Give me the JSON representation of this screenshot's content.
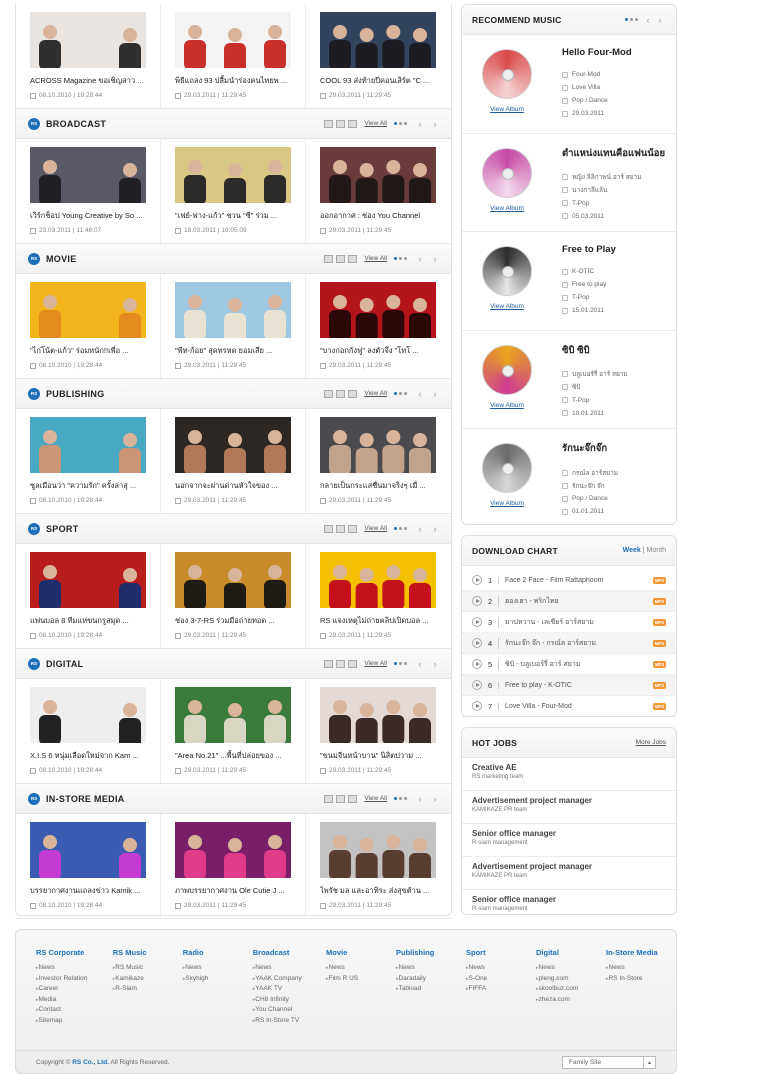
{
  "sections": [
    {
      "title": "",
      "items": [
        {
          "caption": "ACROSS Magazine ขอเชิญสาว ...",
          "date": "08.10.2010 | 19:28:44",
          "c1": "#e9e4e0",
          "c2": "#2f2f2f"
        },
        {
          "caption": "พิธีแถลง 93 ปลื้มนำร่องคนไทยพ ...",
          "date": "29.03.2011 | 11:29:45",
          "c1": "#f3f3f3",
          "c2": "#c9302c"
        },
        {
          "caption": "COOL 93 ส่งท้ายปีคอนเสิร์ต \"C ...",
          "date": "29.03.2011 | 11:29:45",
          "c1": "#33435e",
          "c2": "#1c1c22"
        }
      ]
    },
    {
      "title": "BROADCAST",
      "items": [
        {
          "caption": "เวิร์กช็อป Young Creative by So ...",
          "date": "23.03.2011 | 11:48:07",
          "c1": "#5a5a66",
          "c2": "#1f1f24"
        },
        {
          "caption": "\"เฟย์-ฟาง-แก้ว\" ชวน \"ซี\" ร่วม ...",
          "date": "18.03.2011 | 16:05:09",
          "c1": "#d8c884",
          "c2": "#2c2a28"
        },
        {
          "caption": "ออกอากาศ : ช่อง You Channel",
          "date": "29.03.2011 | 11:29:45",
          "c1": "#6a3b3b",
          "c2": "#231818"
        }
      ]
    },
    {
      "title": "MOVIE",
      "items": [
        {
          "caption": "\"ไก่โน้ต-แก้ว\" ร่อมหนัก!!เพื่อ ...",
          "date": "08.10.2010 | 19:28:44",
          "c1": "#f2b41d",
          "c2": "#e58a1c"
        },
        {
          "caption": "\"พีท-ก้อย\" สุดทรหด ยอมเสีย ...",
          "date": "29.03.2011 | 11:29:45",
          "c1": "#9ec7e2",
          "c2": "#e8e2d2"
        },
        {
          "caption": "\"บางกอกกังฟู\" ลงตัวจึง \"โทโ ...",
          "date": "29.03.2011 | 11:29:45",
          "c1": "#b3151a",
          "c2": "#2b0708"
        }
      ]
    },
    {
      "title": "PUBLISHING",
      "items": [
        {
          "caption": "ซูลเมือนว่า \"ความรัก\" ครั้งล่าสุ ...",
          "date": "08.10.2010 | 19:28:44",
          "c1": "#49a9c1",
          "c2": "#c89677"
        },
        {
          "caption": "นอกจากจะผ่านด่านหัวใจของ ...",
          "date": "29.03.2011 | 11:29:45",
          "c1": "#2c2723",
          "c2": "#b07a5a"
        },
        {
          "caption": "กลายเป็นกระแสชื่นมาจริงๆ เมื่ ...",
          "date": "29.03.2011 | 11:29:45",
          "c1": "#4a4a4f",
          "c2": "#c3a38c"
        }
      ]
    },
    {
      "title": "SPORT",
      "items": [
        {
          "caption": "แฟนบอล 8 ทีมแห่ขนกรูสมุด ...",
          "date": "08.10.2010 | 19:28:44",
          "c1": "#b81c1c",
          "c2": "#1e2d6b"
        },
        {
          "caption": "ช่อง 3-7-RS ร่วมมือถ่ายทอด ...",
          "date": "29.03.2011 | 11:29:45",
          "c1": "#c98b2a",
          "c2": "#201a14"
        },
        {
          "caption": "RS แจงเหตุไม่ถ่ายคลิปเปิดบอล ...",
          "date": "29.03.2011 | 11:29:45",
          "c1": "#f5c000",
          "c2": "#c3121c"
        }
      ]
    },
    {
      "title": "DIGITAL",
      "items": [
        {
          "caption": "X.I.S 6 หนุ่มเลือดใหม่จาก Kam ...",
          "date": "08.10.2010 | 19:28:44",
          "c1": "#eeeeee",
          "c2": "#222222"
        },
        {
          "caption": "\"Area No.21\" ...พื้นที่ปล่อยของ ...",
          "date": "29.03.2011 | 11:29:45",
          "c1": "#3a7a3a",
          "c2": "#d9d6c4"
        },
        {
          "caption": "\"ขนมจีนหน้าบาน\" นิสิตปวาม ...",
          "date": "29.03.2011 | 11:29:45",
          "c1": "#e4d9d4",
          "c2": "#3b2a26"
        }
      ]
    },
    {
      "title": "IN-STORE MEDIA",
      "items": [
        {
          "caption": "บรรยากาศงานแถลงข่าว Kamik ...",
          "date": "08.10.2010 | 19:28:44",
          "c1": "#3a5bb0",
          "c2": "#c33bd1"
        },
        {
          "caption": "ภาพบรรยากาศงาน Ole Cutie J ...",
          "date": "29.03.2011 | 11:29:45",
          "c1": "#7a1e6a",
          "c2": "#e03b8a"
        },
        {
          "caption": "ไพรัช มล และอาทิระ ส่งสุขต้าน ...",
          "date": "29.03.2011 | 11:29:45",
          "c1": "#c3c3c3",
          "c2": "#5a3d32"
        }
      ]
    }
  ],
  "view_all": "View All",
  "recommend": {
    "title": "RECOMMEND MUSIC",
    "view_album": "View Album",
    "albums": [
      {
        "name": "Hello Four-Mod",
        "artist": "Four-Mod",
        "song": "Love Villa",
        "genre": "Pop / Dance",
        "date": "29.03.2011",
        "c1": "#d94a4a",
        "c2": "#f4d2d2"
      },
      {
        "name": "ตำแหน่งแทนคือแฟนน้อย",
        "artist": "หญิง ลิลิกาพน์ อาร์ สยาม",
        "song": "นางกาลีแล้น",
        "genre": "T-Pop",
        "date": "05.03.2011",
        "c1": "#c64aa6",
        "c2": "#f2d8ea"
      },
      {
        "name": "Free to Play",
        "artist": "K-OTIC",
        "song": "Free to play",
        "genre": "T-Pop",
        "date": "15.01.2011",
        "c1": "#2d2d2d",
        "c2": "#e6e6e6"
      },
      {
        "name": "ซิบิ ซิบิ",
        "artist": "บลูเบอร์รี่ อาร์ สยาม",
        "song": "ซิบิ",
        "genre": "T-Pop",
        "date": "10.01.2011",
        "c1": "#e8a51c",
        "c2": "#cf3d92"
      },
      {
        "name": "รักนะจ๊กจ๊ก",
        "artist": "กรณ์ล อาร์สยาม",
        "song": "รักนะจ๊ก จ๊ก",
        "genre": "Pop / Dance",
        "date": "01.01.2011",
        "c1": "#6b6b6b",
        "c2": "#d6d6d6"
      }
    ]
  },
  "download": {
    "title": "DOWNLOAD CHART",
    "tab_week": "Week",
    "tab_month": "Month",
    "mp3": "MP3",
    "rows": [
      {
        "rank": "1",
        "song": "Face 2 Face - Film Rattaphoom"
      },
      {
        "rank": "2",
        "song": "ฮองเฮา - พริกไทย"
      },
      {
        "rank": "3",
        "song": "มาปหวาน - เลเชียร์ อาร์สยาม"
      },
      {
        "rank": "4",
        "song": "รักนะจ๊ก จ๊ก - กรณ์ล อาร์สยาม"
      },
      {
        "rank": "5",
        "song": "ซิบิ - บลูเบอร์รี่ อาร์ สยาม"
      },
      {
        "rank": "6",
        "song": "Free to play - K-OTIC"
      },
      {
        "rank": "7",
        "song": "Love Villa - Four-Mod"
      }
    ]
  },
  "jobs": {
    "title": "HOT JOBS",
    "more": "More Jobs",
    "items": [
      {
        "title": "Creative AE",
        "team": "RS marketing team"
      },
      {
        "title": "Advertisement project manager",
        "team": "KAMIKAZE PR team"
      },
      {
        "title": "Senior office manager",
        "team": "R-siam management"
      },
      {
        "title": "Advertisement project manager",
        "team": "KAMIKAZE PR team"
      },
      {
        "title": "Senior office manager",
        "team": "R-siam management"
      }
    ]
  },
  "footer": {
    "columns": [
      {
        "title": "RS Corporate",
        "links": [
          "News",
          "Investor Relation",
          "Career",
          "Media",
          "Contact",
          "Sitemap"
        ]
      },
      {
        "title": "RS Music",
        "links": [
          "RS Music",
          "Kamikaze",
          "R-Siam"
        ]
      },
      {
        "title": "Radio",
        "links": [
          "News",
          "Skyhigh"
        ]
      },
      {
        "title": "Broadcast",
        "links": [
          "News",
          "YAAK Company",
          "YAAK TV",
          "CH8 Infinity",
          "You Channel",
          "RS In-Store TV"
        ]
      },
      {
        "title": "Movie",
        "links": [
          "News",
          "Film R US"
        ]
      },
      {
        "title": "Publishing",
        "links": [
          "News",
          "Daradaily",
          "Tabload"
        ]
      },
      {
        "title": "Sport",
        "links": [
          "News",
          "S-One",
          "FIFFA"
        ]
      },
      {
        "title": "Digital",
        "links": [
          "News",
          "pleng.com",
          "skoolbuz.com",
          "zheza.com"
        ]
      },
      {
        "title": "In-Store Media",
        "links": [
          "News",
          "RS In-Store"
        ]
      }
    ],
    "copyright_pre": "Copyright ©",
    "copyright_brand": "RS Co., Ltd.",
    "copyright_post": "All Rights Reserved.",
    "family_site": "Family Site"
  }
}
